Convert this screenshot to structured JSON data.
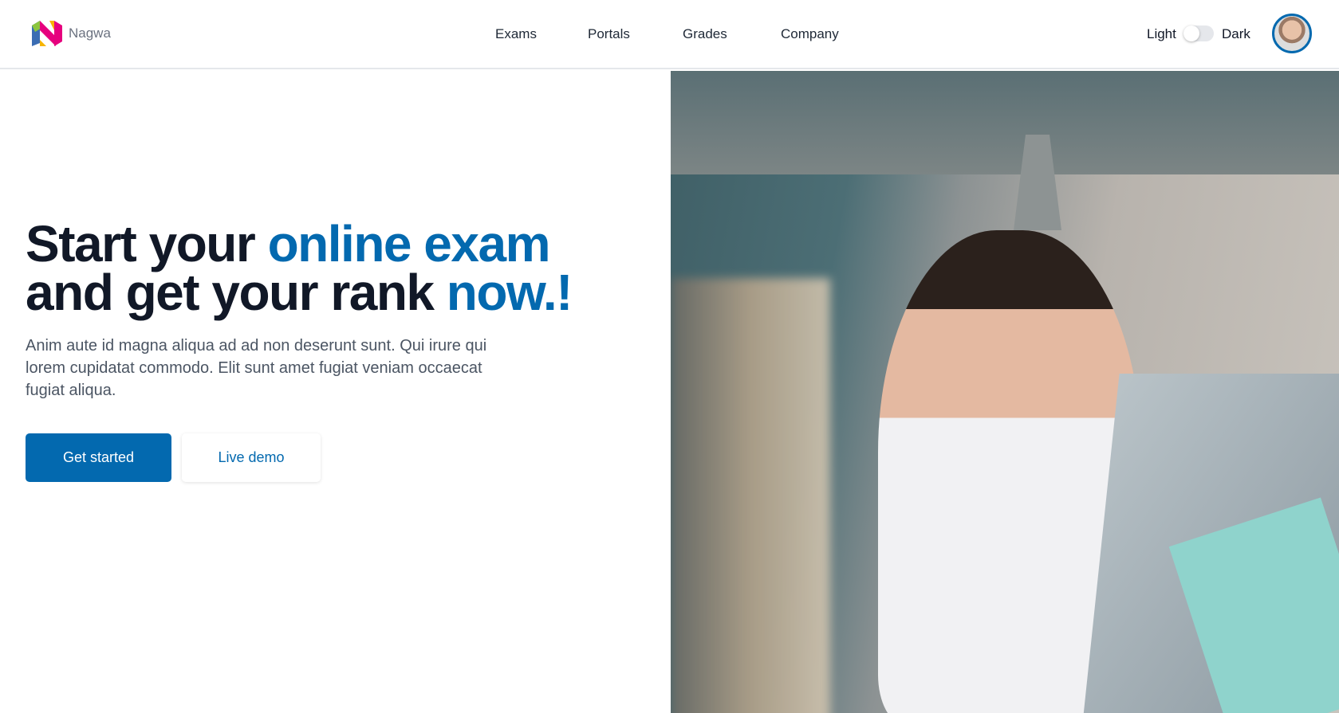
{
  "brand": {
    "name": "Nagwa",
    "colors": {
      "accent": "#0369af",
      "text": "#111827"
    }
  },
  "nav": {
    "items": [
      {
        "label": "Exams"
      },
      {
        "label": "Portals"
      },
      {
        "label": "Grades"
      },
      {
        "label": "Company"
      }
    ]
  },
  "theme": {
    "light_label": "Light",
    "dark_label": "Dark",
    "dark_enabled": false
  },
  "hero": {
    "title_part1": "Start your ",
    "title_accent1": "online exam",
    "title_part2": "and get your rank ",
    "title_accent2": "now.!",
    "description": "Anim aute id magna aliqua ad ad non deserunt sunt. Qui irure qui lorem cupidatat commodo. Elit sunt amet fugiat veniam occaecat fugiat aliqua.",
    "primary_button": "Get started",
    "secondary_button": "Live demo"
  }
}
